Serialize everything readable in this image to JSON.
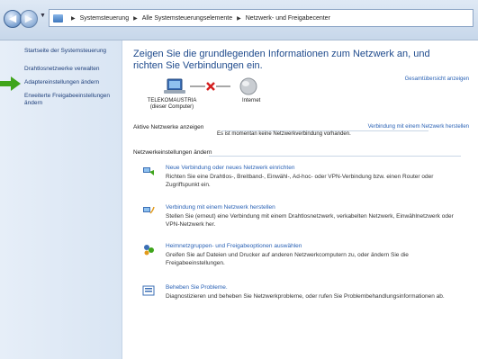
{
  "address_bar": {
    "crumbs": [
      "Systemsteuerung",
      "Alle Systemsteuerungselemente",
      "Netzwerk- und Freigabecenter"
    ]
  },
  "sidebar": {
    "items": [
      {
        "label": "Startseite der Systemsteuerung"
      },
      {
        "label": "Drahtlosnetzwerke verwalten"
      },
      {
        "label": "Adaptereinstellungen ändern"
      },
      {
        "label": "Erweiterte Freigabeeinstellungen ändern"
      }
    ]
  },
  "main": {
    "title": "Zeigen Sie die grundlegenden Informationen zum Netzwerk an, und richten Sie Verbindungen ein.",
    "overview_link": "Gesamtübersicht anzeigen",
    "map": {
      "computer_name": "TELEKOMAUSTRIA",
      "computer_sub": "(dieser Computer)",
      "internet_label": "Internet"
    },
    "active_networks": {
      "heading": "Aktive Netzwerke anzeigen",
      "connect_link": "Verbindung mit einem Netzwerk herstellen",
      "status": "Es ist momentan keine Netzwerkverbindung vorhanden."
    },
    "settings": {
      "heading": "Netzwerkeinstellungen ändern",
      "tasks": [
        {
          "link": "Neue Verbindung oder neues Netzwerk einrichten",
          "desc": "Richten Sie eine Drahtlos-, Breitband-, Einwähl-, Ad-hoc- oder VPN-Verbindung bzw. einen Router oder Zugriffspunkt ein."
        },
        {
          "link": "Verbindung mit einem Netzwerk herstellen",
          "desc": "Stellen Sie (erneut) eine Verbindung mit einem Drahtlosnetzwerk, verkabelten Netzwerk, Einwählnetzwerk oder VPN-Netzwerk her."
        },
        {
          "link": "Heimnetzgruppen- und Freigabeoptionen auswählen",
          "desc": "Greifen Sie auf Dateien und Drucker auf anderen Netzwerkcomputern zu, oder ändern Sie die Freigabeeinstellungen."
        },
        {
          "link": "Beheben Sie Probleme.",
          "desc": "Diagnostizieren und beheben Sie Netzwerkprobleme, oder rufen Sie Problembehandlungsinformationen ab."
        }
      ]
    }
  },
  "colors": {
    "link": "#2a62b5",
    "title": "#1e4a8c",
    "sidebar_bg": "#dfe9f5",
    "highlight_arrow": "#3fa51b",
    "disconnect_x": "#d42020"
  }
}
